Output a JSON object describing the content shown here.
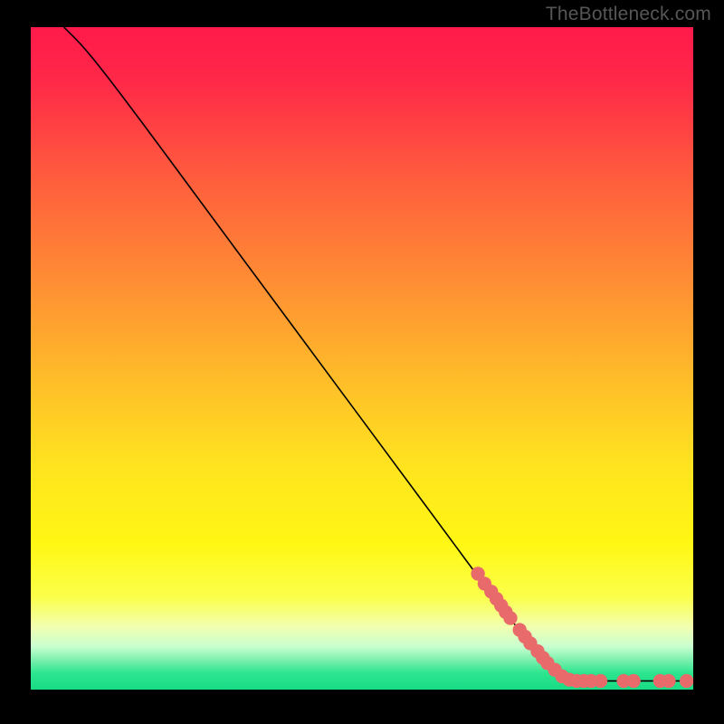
{
  "watermark": "TheBottleneck.com",
  "chart_data": {
    "type": "line",
    "title": "",
    "xlabel": "",
    "ylabel": "",
    "xlim": [
      0,
      100
    ],
    "ylim": [
      0,
      100
    ],
    "curve": [
      {
        "x": 5,
        "y": 100
      },
      {
        "x": 8,
        "y": 97
      },
      {
        "x": 12,
        "y": 92
      },
      {
        "x": 18,
        "y": 84
      },
      {
        "x": 25,
        "y": 74.5
      },
      {
        "x": 35,
        "y": 61
      },
      {
        "x": 45,
        "y": 47.5
      },
      {
        "x": 55,
        "y": 34
      },
      {
        "x": 65,
        "y": 20.5
      },
      {
        "x": 72,
        "y": 11
      },
      {
        "x": 78,
        "y": 4
      },
      {
        "x": 80,
        "y": 2
      },
      {
        "x": 82,
        "y": 1.3
      },
      {
        "x": 86,
        "y": 1.3
      },
      {
        "x": 90,
        "y": 1.3
      },
      {
        "x": 94,
        "y": 1.3
      },
      {
        "x": 97,
        "y": 1.3
      },
      {
        "x": 99,
        "y": 1.3
      }
    ],
    "points": [
      {
        "x": 67.5,
        "y": 17.5
      },
      {
        "x": 68.5,
        "y": 16
      },
      {
        "x": 69.5,
        "y": 14.8
      },
      {
        "x": 70.3,
        "y": 13.7
      },
      {
        "x": 71.0,
        "y": 12.7
      },
      {
        "x": 71.7,
        "y": 11.7
      },
      {
        "x": 72.4,
        "y": 10.8
      },
      {
        "x": 73.8,
        "y": 9.0
      },
      {
        "x": 74.6,
        "y": 8.0
      },
      {
        "x": 75.4,
        "y": 7.0
      },
      {
        "x": 76.5,
        "y": 5.8
      },
      {
        "x": 77.3,
        "y": 4.8
      },
      {
        "x": 78.0,
        "y": 4.0
      },
      {
        "x": 79.1,
        "y": 3.0
      },
      {
        "x": 80.2,
        "y": 2.0
      },
      {
        "x": 81.3,
        "y": 1.5
      },
      {
        "x": 82.4,
        "y": 1.3
      },
      {
        "x": 83.5,
        "y": 1.3
      },
      {
        "x": 84.6,
        "y": 1.3
      },
      {
        "x": 86.0,
        "y": 1.3
      },
      {
        "x": 89.5,
        "y": 1.3
      },
      {
        "x": 91.0,
        "y": 1.3
      },
      {
        "x": 95.0,
        "y": 1.3
      },
      {
        "x": 96.3,
        "y": 1.3
      },
      {
        "x": 99.0,
        "y": 1.3
      }
    ],
    "gradient_stops": [
      {
        "pos": 0.0,
        "color": "#ff1a4b"
      },
      {
        "pos": 0.08,
        "color": "#ff2848"
      },
      {
        "pos": 0.22,
        "color": "#ff5a3e"
      },
      {
        "pos": 0.38,
        "color": "#ff8c34"
      },
      {
        "pos": 0.52,
        "color": "#ffb92a"
      },
      {
        "pos": 0.66,
        "color": "#ffe31f"
      },
      {
        "pos": 0.78,
        "color": "#fff714"
      },
      {
        "pos": 0.86,
        "color": "#fbff4a"
      },
      {
        "pos": 0.905,
        "color": "#f2ffb0"
      },
      {
        "pos": 0.935,
        "color": "#c8ffd0"
      },
      {
        "pos": 0.955,
        "color": "#7df0ae"
      },
      {
        "pos": 0.975,
        "color": "#2de58f"
      },
      {
        "pos": 1.0,
        "color": "#18db84"
      }
    ],
    "point_color": "#e86a6a",
    "line_color": "#000000"
  }
}
